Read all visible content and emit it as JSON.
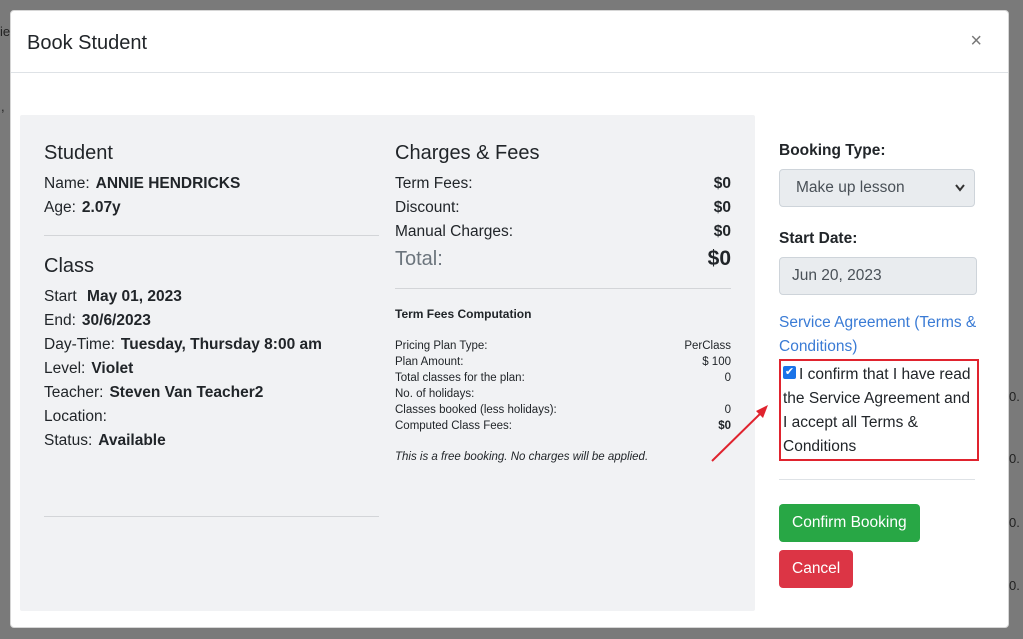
{
  "background": {
    "fragment_top": "ie",
    "fragment_mid": ",",
    "right_fragments": [
      "0.",
      "0.",
      "0.",
      "0."
    ]
  },
  "modal": {
    "title": "Book Student",
    "close_label": "×"
  },
  "student": {
    "heading": "Student",
    "name_label": "Name:",
    "name_value": "ANNIE HENDRICKS",
    "age_label": "Age:",
    "age_value": "2.07y"
  },
  "class_info": {
    "heading": "Class",
    "start_label": "Start",
    "start_value": "May 01, 2023",
    "end_label": "End:",
    "end_value": "30/6/2023",
    "daytime_label": "Day-Time:",
    "daytime_value": "Tuesday, Thursday 8:00 am",
    "level_label": "Level:",
    "level_value": "Violet",
    "teacher_label": "Teacher:",
    "teacher_value": "Steven Van Teacher2",
    "location_label": "Location:",
    "location_value": "",
    "status_label": "Status:",
    "status_value": "Available"
  },
  "charges": {
    "heading": "Charges & Fees",
    "rows": [
      {
        "label": "Term Fees:",
        "value": "$0"
      },
      {
        "label": "Discount:",
        "value": "$0"
      },
      {
        "label": "Manual Charges:",
        "value": "$0"
      }
    ],
    "total_label": "Total:",
    "total_value": "$0"
  },
  "computation": {
    "title": "Term Fees Computation",
    "rows": [
      {
        "label": "Pricing Plan Type:",
        "value": "PerClass"
      },
      {
        "label": "Plan Amount:",
        "value": "$ 100"
      },
      {
        "label": "Total classes for the plan:",
        "value": "0"
      },
      {
        "label": "No. of holidays:",
        "value": ""
      },
      {
        "label": "Classes booked (less holidays):",
        "value": "0"
      },
      {
        "label": "Computed Class Fees:",
        "value": "$0"
      }
    ],
    "note": "This is a free booking. No charges will be applied."
  },
  "side": {
    "booking_type_label": "Booking Type:",
    "booking_type_value": "Make up lesson",
    "start_date_label": "Start Date:",
    "start_date_value": "Jun 20, 2023",
    "agreement_link": "Service Agreement (Terms & Conditions)",
    "confirm_text": "I confirm that I have read the Service Agreement and I accept all Terms & Conditions",
    "confirm_checked": true,
    "confirm_button": "Confirm Booking",
    "cancel_button": "Cancel"
  },
  "colors": {
    "confirm_green": "#28a745",
    "cancel_red": "#dc3545",
    "highlight_red": "#e0232e",
    "link_blue": "#3a7bd5"
  }
}
